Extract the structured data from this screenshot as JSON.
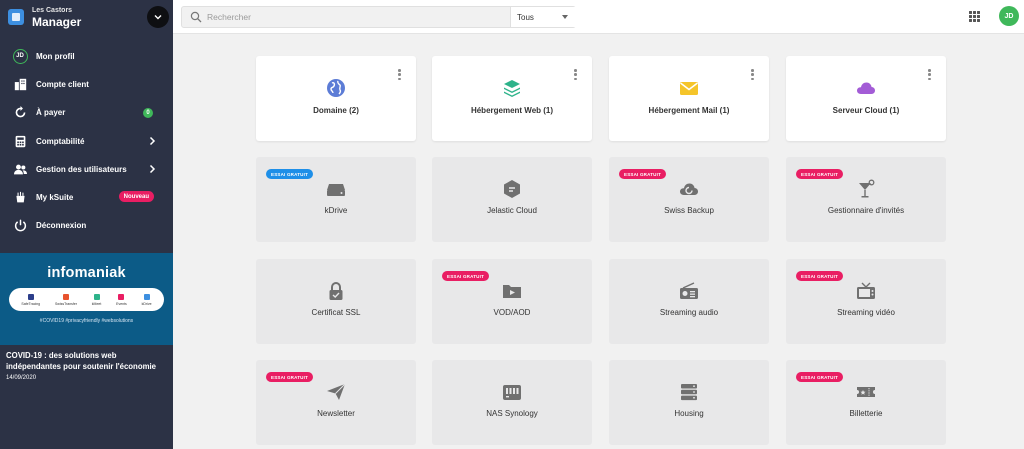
{
  "brand": {
    "subtitle": "Les Castors",
    "title": "Manager"
  },
  "sidebar": {
    "items": [
      {
        "label": "Mon profil",
        "icon": "avatar",
        "initials": "JD"
      },
      {
        "label": "Compte client",
        "icon": "building-icon"
      },
      {
        "label": "À payer",
        "icon": "refresh-icon",
        "badge": "0"
      },
      {
        "label": "Comptabilité",
        "icon": "calculator-icon",
        "chevron": true
      },
      {
        "label": "Gestion des utilisateurs",
        "icon": "users-icon",
        "chevron": true
      },
      {
        "label": "My kSuite",
        "icon": "ksuite-icon",
        "badge": "Nouveau"
      },
      {
        "label": "Déconnexion",
        "icon": "power-icon"
      }
    ]
  },
  "promo": {
    "logo": "infomaniak",
    "apps": [
      "SafeTracing",
      "SwissTransfer",
      "kMeet",
      "Events",
      "kDrive"
    ],
    "tags": "#COVID19 #privacyfriendly #websolutions"
  },
  "news": {
    "title": "COVID-19 : des solutions web indépendantes pour soutenir l'économie",
    "date": "14/09/2020"
  },
  "topbar": {
    "search_placeholder": "Rechercher",
    "filter_value": "Tous",
    "user_initials": "JD"
  },
  "badge_text": "ESSAI GRATUIT",
  "products": [
    {
      "label": "Domaine (2)",
      "icon": "globe-icon",
      "color": "#5c7cd6"
    },
    {
      "label": "Hébergement Web (1)",
      "icon": "layers-icon",
      "color": "#2db38a"
    },
    {
      "label": "Hébergement Mail (1)",
      "icon": "mail-icon",
      "color": "#f5c52a"
    },
    {
      "label": "Serveur Cloud (1)",
      "icon": "cloud-icon",
      "color": "#a35cd6"
    }
  ],
  "services": [
    {
      "label": "kDrive",
      "icon": "drive-icon",
      "trial": "blue"
    },
    {
      "label": "Jelastic Cloud",
      "icon": "jelastic-icon",
      "trial": ""
    },
    {
      "label": "Swiss Backup",
      "icon": "backup-icon",
      "trial": "pink"
    },
    {
      "label": "Gestionnaire d'invités",
      "icon": "cocktail-icon",
      "trial": "pink"
    },
    {
      "label": "Certificat SSL",
      "icon": "lock-icon",
      "trial": ""
    },
    {
      "label": "VOD/AOD",
      "icon": "video-folder-icon",
      "trial": "pink"
    },
    {
      "label": "Streaming audio",
      "icon": "radio-icon",
      "trial": ""
    },
    {
      "label": "Streaming vidéo",
      "icon": "tv-icon",
      "trial": "pink"
    },
    {
      "label": "Newsletter",
      "icon": "send-icon",
      "trial": "pink"
    },
    {
      "label": "NAS Synology",
      "icon": "nas-icon",
      "trial": ""
    },
    {
      "label": "Housing",
      "icon": "server-icon",
      "trial": ""
    },
    {
      "label": "Billetterie",
      "icon": "ticket-icon",
      "trial": "pink"
    }
  ],
  "colors": {
    "sidebar": "#2c3245",
    "accent_green": "#3fb85a",
    "trial_pink": "#e91e63",
    "trial_blue": "#1e8fe8",
    "service_icon": "#707070"
  }
}
